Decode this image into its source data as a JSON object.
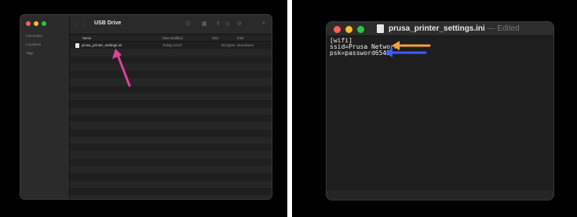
{
  "finder": {
    "title": "USB Drive",
    "sidebar": [
      "Favourites",
      "Locations",
      "Tags"
    ],
    "columns": {
      "name": "Name",
      "date": "Date Modified",
      "size": "Size",
      "kind": "Kind"
    },
    "file": {
      "name": "prusa_printer_settings.ini",
      "date": "Today 14:47",
      "size": "51 bytes",
      "kind": "Document"
    },
    "toolbar_icons": [
      "view-grid-icon",
      "group-icon",
      "share-icon",
      "tag-icon",
      "action-icon",
      "search-icon"
    ]
  },
  "textedit": {
    "title": "prusa_printer_settings.ini",
    "edited": "— Edited",
    "lines": [
      "[wifi]",
      "ssid=Prusa Network",
      "psk=password6543"
    ]
  },
  "annotations": {
    "pointer_arrow_color": "#e0409a",
    "ssid_arrow_color": "#f5a03c",
    "psk_arrow_color": "#3c5ef5"
  }
}
